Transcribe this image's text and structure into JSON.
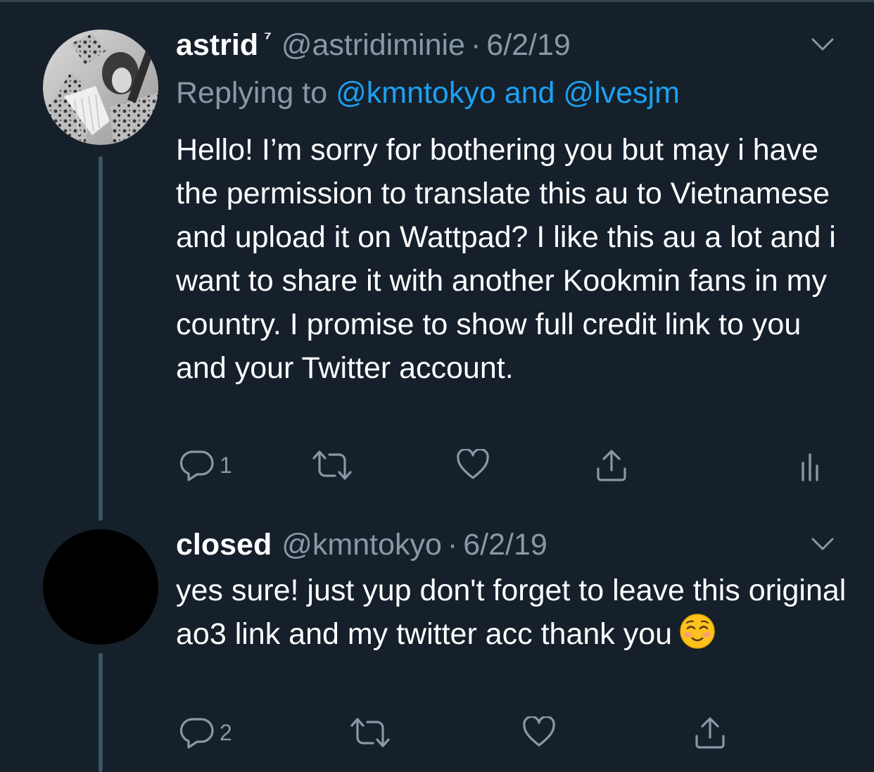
{
  "tweets": [
    {
      "name": "astrid",
      "badge": "⁷",
      "handle": "@astridiminie",
      "separator": "·",
      "date": "6/2/19",
      "replying_prefix": "Replying to",
      "replying_mention_1": "@kmntokyo",
      "replying_and": "and",
      "replying_mention_2": "@lvesjm",
      "text": "Hello! I’m sorry for bothering you but may i have the permission to translate this au to Vietnamese and upload it on Wattpad? I like this au a lot and i want to share it with another Kookmin fans in my country. I promise to show full credit link to you and your Twitter account.",
      "reply_count": "1",
      "icons": [
        "reply-icon",
        "retweet-icon",
        "like-icon",
        "share-icon",
        "analytics-icon",
        "chevron-down-icon"
      ]
    },
    {
      "name": "closed",
      "handle": "@kmntokyo",
      "separator": "·",
      "date": "6/2/19",
      "text": "yes sure! just yup don't forget to leave this original ao3 link and my twitter acc thank you",
      "emoji": "☺️",
      "reply_count": "2",
      "icons": [
        "reply-icon",
        "retweet-icon",
        "like-icon",
        "share-icon",
        "chevron-down-icon"
      ]
    }
  ],
  "colors": {
    "background": "#15202b",
    "secondary_text": "#8899a6",
    "link": "#1da1f2",
    "thread_line": "#3d5466"
  }
}
